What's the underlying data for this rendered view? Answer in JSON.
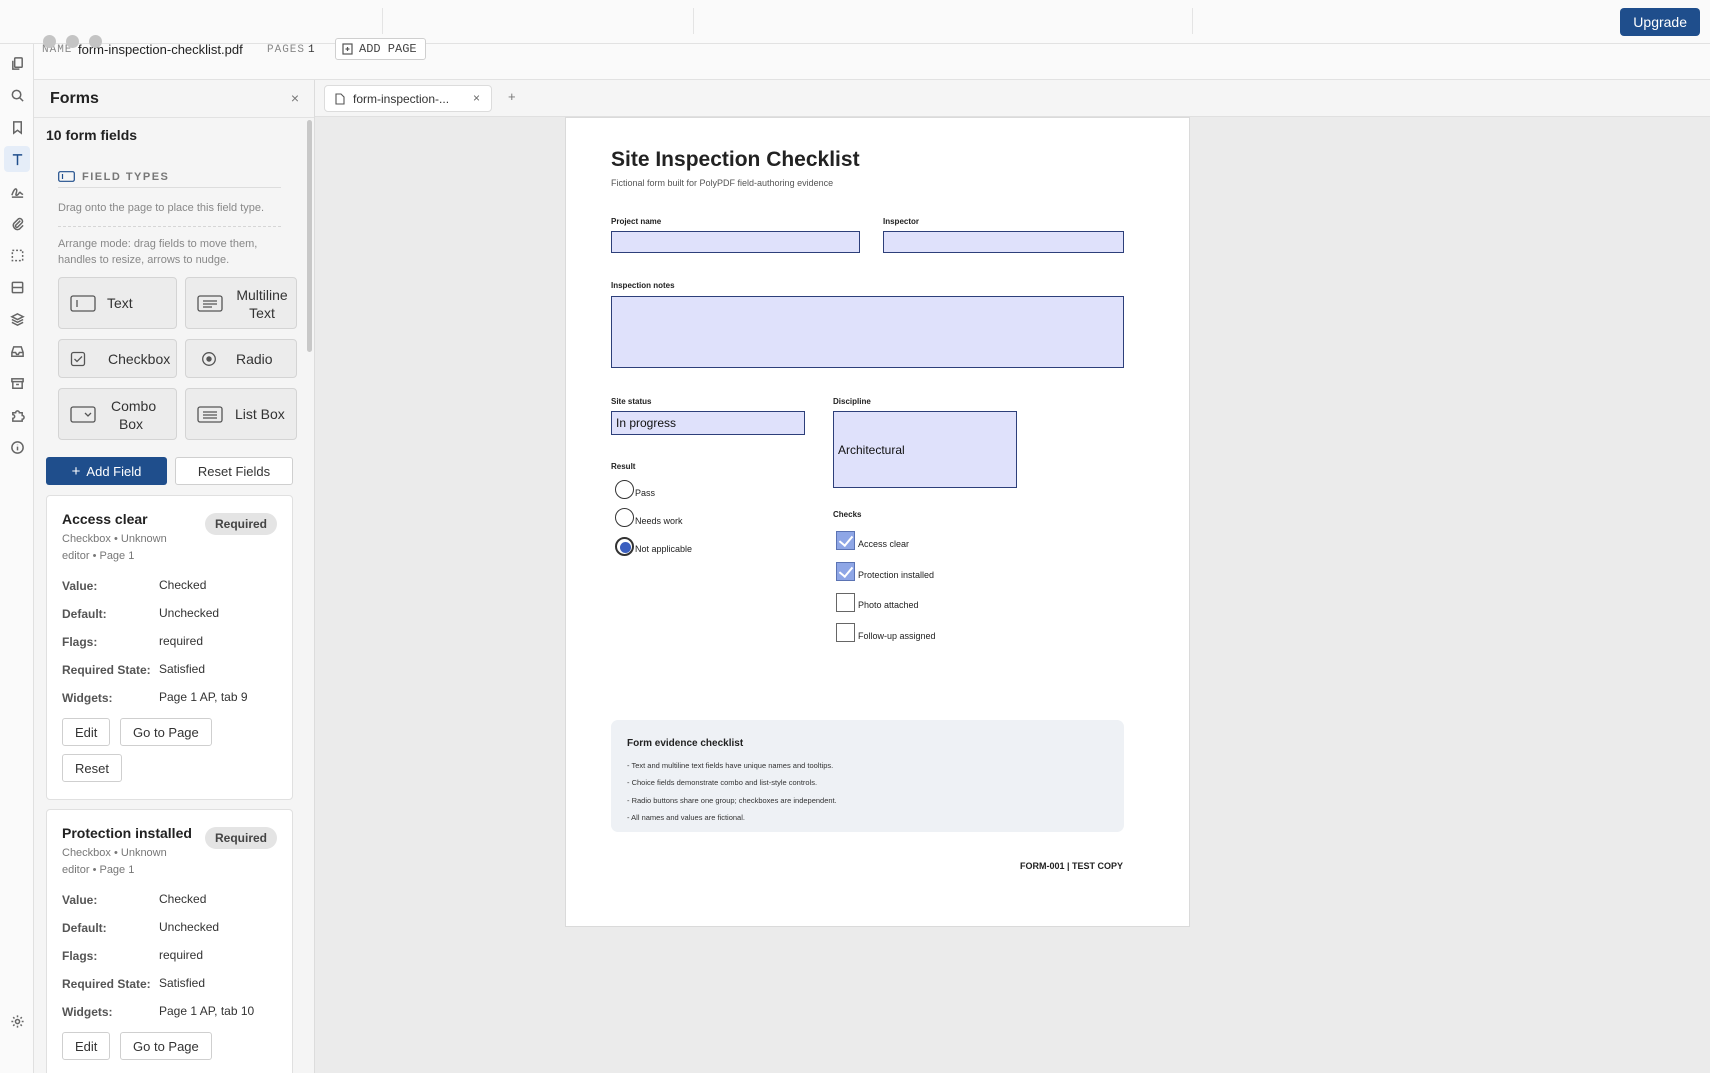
{
  "topbar": {
    "upgrade_label": "Upgrade"
  },
  "docbar": {
    "name_label": "NAME",
    "file_name": "form-inspection-checklist.pdf",
    "pages_label": "PAGES",
    "pages_count": "1",
    "add_page_label": "ADD PAGE"
  },
  "panel": {
    "title": "Forms",
    "close": "×",
    "field_count": "10 form fields",
    "field_types_heading": "FIELD TYPES",
    "hint_drag": "Drag onto the page to place this field type.",
    "hint_arrange": "Arrange mode: drag fields to move them, handles to resize, arrows to nudge.",
    "types": {
      "text": "Text",
      "multiline": "Multiline Text",
      "checkbox": "Checkbox",
      "radio": "Radio",
      "combo": "Combo Box",
      "listbox": "List Box"
    },
    "add_field_label": "Add Field",
    "reset_fields_label": "Reset Fields",
    "cards": [
      {
        "name": "Access clear",
        "badge": "Required",
        "meta": "Checkbox • Unknown editor • Page 1",
        "value_label": "Value:",
        "value": "Checked",
        "default_label": "Default:",
        "default": "Unchecked",
        "flags_label": "Flags:",
        "flags": "required",
        "req_label": "Required State:",
        "req": "Satisfied",
        "widgets_label": "Widgets:",
        "widgets": "Page 1 AP, tab 9",
        "edit": "Edit",
        "goto": "Go to Page",
        "reset": "Reset"
      },
      {
        "name": "Protection installed",
        "badge": "Required",
        "meta": "Checkbox • Unknown editor • Page 1",
        "value_label": "Value:",
        "value": "Checked",
        "default_label": "Default:",
        "default": "Unchecked",
        "flags_label": "Flags:",
        "flags": "required",
        "req_label": "Required State:",
        "req": "Satisfied",
        "widgets_label": "Widgets:",
        "widgets": "Page 1 AP, tab 10",
        "edit": "Edit",
        "goto": "Go to Page"
      }
    ]
  },
  "tabs": {
    "doc_tab_label": "form-inspection-...",
    "close": "×",
    "new_tab": "+"
  },
  "page": {
    "title": "Site Inspection Checklist",
    "subtitle": "Fictional form built for PolyPDF field-authoring evidence",
    "project_label": "Project name",
    "inspector_label": "Inspector",
    "notes_label": "Inspection notes",
    "status_label": "Site status",
    "status_value": "In progress",
    "discipline_label": "Discipline",
    "discipline_value": "Architectural",
    "result_label": "Result",
    "radios": [
      "Pass",
      "Needs work",
      "Not applicable"
    ],
    "radio_selected": 2,
    "checks_label": "Checks",
    "checks": [
      {
        "label": "Access clear",
        "checked": true
      },
      {
        "label": "Protection installed",
        "checked": true
      },
      {
        "label": "Photo attached",
        "checked": false
      },
      {
        "label": "Follow-up assigned",
        "checked": false
      }
    ],
    "evidence_title": "Form evidence checklist",
    "evidence_lines": [
      "- Text and multiline text fields have unique names and tooltips.",
      "- Choice fields demonstrate combo and list-style controls.",
      "- Radio buttons share one group; checkboxes are independent.",
      "- All names and values are fictional."
    ],
    "footer": "FORM-001 | TEST COPY"
  },
  "colors": {
    "accent": "#1f4e8c",
    "field_fill": "#dfe1fb",
    "field_border": "#2d3f7a",
    "check_fill": "#8ea6e6"
  }
}
